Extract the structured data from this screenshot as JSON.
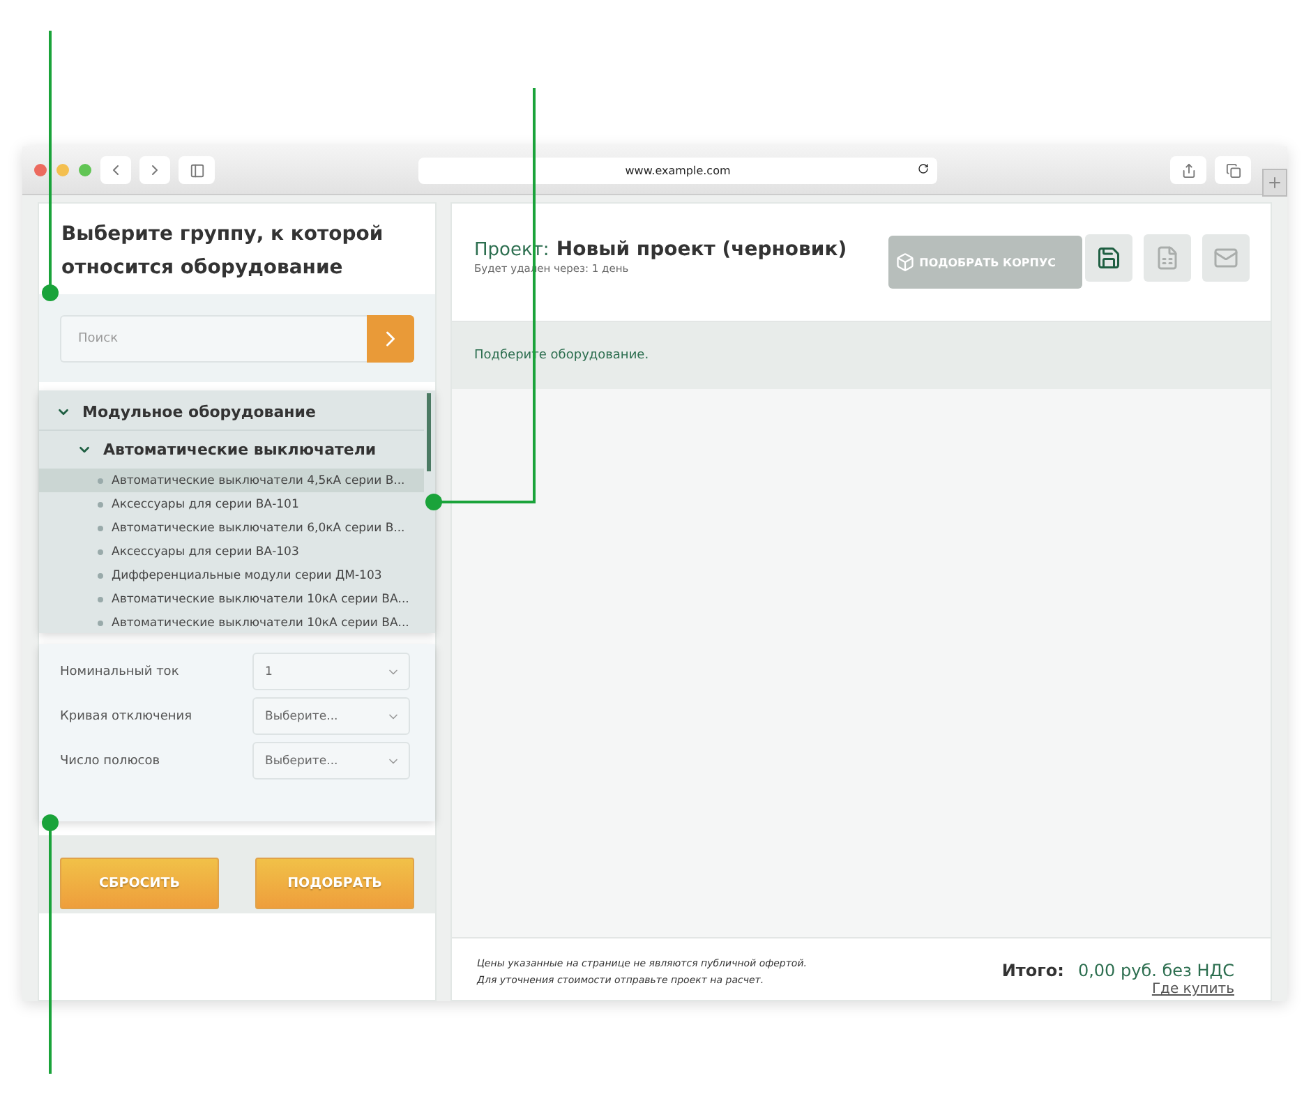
{
  "browser": {
    "url": "www.example.com"
  },
  "left_panel": {
    "title": "Выберите группу, к которой относится оборудование",
    "search": {
      "placeholder": "Поиск"
    },
    "tree": [
      {
        "label": "Модульное оборудование",
        "expanded": true,
        "children": [
          {
            "label": "Автоматические выключатели",
            "expanded": true,
            "children": [
              {
                "label": "Автоматические выключатели 4,5кА серии В...",
                "selected": true
              },
              {
                "label": "Аксессуары для серии ВА-101",
                "selected": false
              },
              {
                "label": "Автоматические выключатели 6,0кА серии В...",
                "selected": false
              },
              {
                "label": "Аксессуары для серии ВА-103",
                "selected": false
              },
              {
                "label": "Дифференциальные модули серии ДМ-103",
                "selected": false
              },
              {
                "label": "Автоматические выключатели 10кА серии ВА...",
                "selected": false
              },
              {
                "label": "Автоматические выключатели 10кА серии ВА...",
                "selected": false
              }
            ]
          }
        ]
      }
    ],
    "filters": [
      {
        "label": "Номинальный ток",
        "value": "1"
      },
      {
        "label": "Кривая отключения",
        "value": "Выберите..."
      },
      {
        "label": "Число полюсов",
        "value": "Выберите..."
      }
    ],
    "buttons": [
      "СБРОСИТЬ",
      "ПОДОБРАТЬ"
    ]
  },
  "project": {
    "label": "Проект:",
    "name": "Новый проект (черновик)",
    "subtitle": "Будет удален через: 1 день",
    "case_button": {
      "label": "ПОДОБРАТЬ КОРПУС",
      "disabled": true
    },
    "tools": [
      {
        "kind": "save",
        "disabled": false
      },
      {
        "kind": "excel",
        "disabled": true
      },
      {
        "kind": "mail",
        "disabled": true
      }
    ],
    "message": "Подберите оборудование."
  },
  "footer": {
    "notes": [
      "Цены указанные на странице не являются публичной офертой.",
      "Для уточнения стоимости отправьте проект на расчет."
    ],
    "total_label": "Итого:",
    "total_value": "0,00 руб. без НДС",
    "link": "Где купить"
  }
}
